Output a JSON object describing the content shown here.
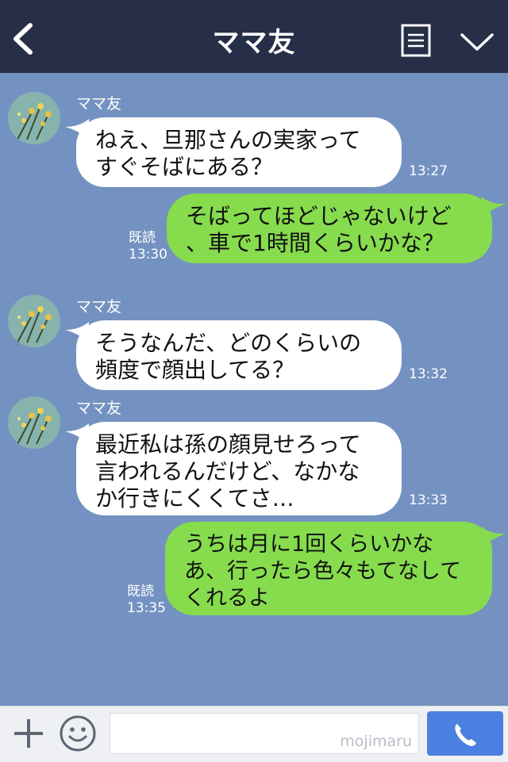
{
  "header": {
    "title": "ママ友",
    "back_icon": "chevron-left-icon",
    "menu_icon": "list-icon",
    "collapse_icon": "chevron-down-icon"
  },
  "messages": [
    {
      "side": "left",
      "sender": "ママ友",
      "text": "ねえ、旦那さんの実家って\nすぐそばにある？",
      "time": "13:27"
    },
    {
      "side": "right",
      "read": "既読",
      "text": "そばってほどじゃないけど\n、車で1時間くらいかな？",
      "time": "13:30"
    },
    {
      "side": "left",
      "sender": "ママ友",
      "text": "そうなんだ、どのくらいの\n頻度で顔出してる？",
      "time": "13:32"
    },
    {
      "side": "left",
      "sender": "ママ友",
      "text": "最近私は孫の顔見せろって\n言われるんだけど、なかな\nか行きにくくてさ…",
      "time": "13:33"
    },
    {
      "side": "right",
      "read": "既読",
      "text": "うちは月に1回くらいかな\nあ、行ったら色々もてなして\nくれるよ",
      "time": "13:35"
    }
  ],
  "footer": {
    "input_value": "",
    "watermark": "mojimaru",
    "plus_icon": "plus-icon",
    "emoji_icon": "smiley-icon",
    "call_icon": "phone-icon"
  },
  "colors": {
    "header_bg": "#262f47",
    "chat_bg": "#7492c1",
    "sent_bubble": "#86dc4d",
    "received_bubble": "#ffffff",
    "call_button": "#4b7fe0"
  }
}
